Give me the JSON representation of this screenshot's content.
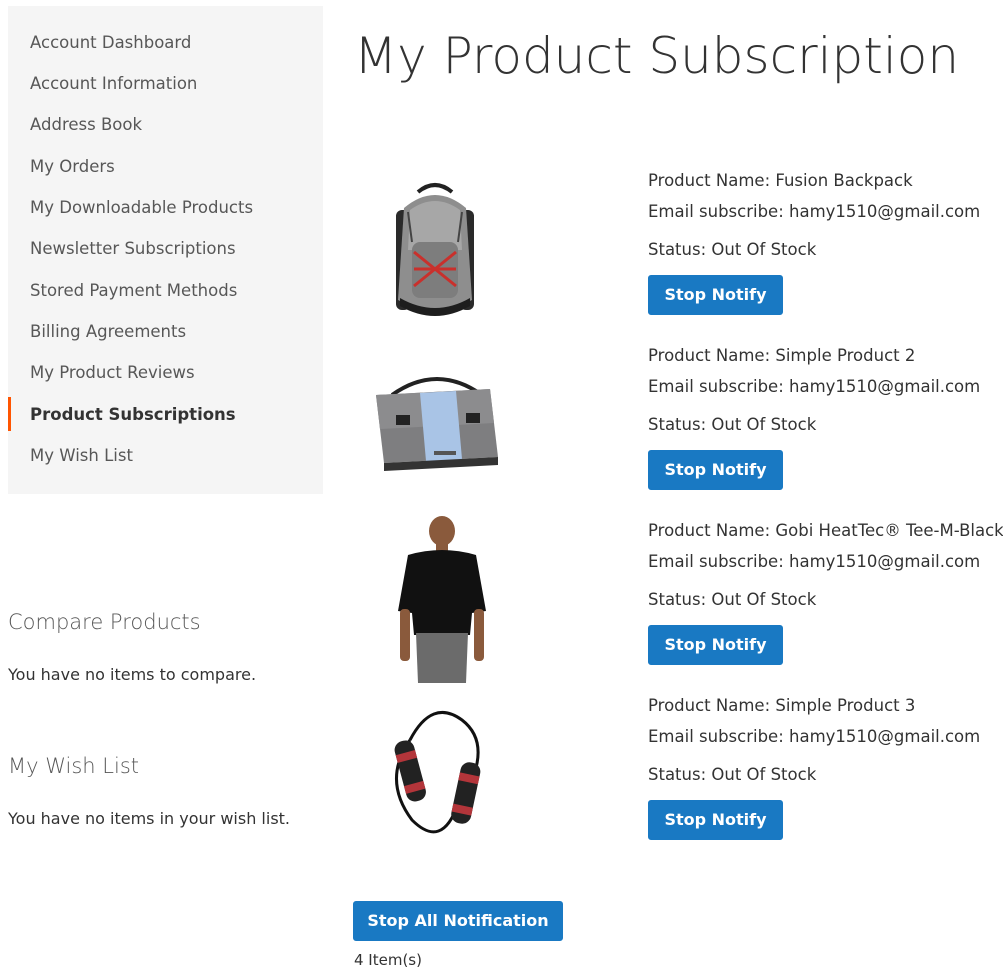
{
  "sidebar": {
    "items": [
      {
        "label": "Account Dashboard",
        "active": false
      },
      {
        "label": "Account Information",
        "active": false
      },
      {
        "label": "Address Book",
        "active": false
      },
      {
        "label": "My Orders",
        "active": false
      },
      {
        "label": "My Downloadable Products",
        "active": false
      },
      {
        "label": "Newsletter Subscriptions",
        "active": false
      },
      {
        "label": "Stored Payment Methods",
        "active": false
      },
      {
        "label": "Billing Agreements",
        "active": false
      },
      {
        "label": "My Product Reviews",
        "active": false
      },
      {
        "label": "Product Subscriptions",
        "active": true
      },
      {
        "label": "My Wish List",
        "active": false
      }
    ],
    "active_color": "#ff5501"
  },
  "compare": {
    "title": "Compare Products",
    "empty_text": "You have no items to compare."
  },
  "wishlist": {
    "title": "My Wish List",
    "empty_text": "You have no items in your wish list."
  },
  "main": {
    "title": "My Product Subscription",
    "subscriptions": [
      {
        "image_icon": "backpack-image",
        "name_line": "Product Name: Fusion Backpack",
        "email_line": "Email subscribe: hamy1510@gmail.com",
        "status_line": "Status: Out Of Stock",
        "button_label": "Stop Notify"
      },
      {
        "image_icon": "messenger-bag-image",
        "name_line": "Product Name: Simple Product 2",
        "email_line": "Email subscribe: hamy1510@gmail.com",
        "status_line": "Status: Out Of Stock",
        "button_label": "Stop Notify"
      },
      {
        "image_icon": "tshirt-model-image",
        "name_line": "Product Name: Gobi HeatTec® Tee-M-Black",
        "email_line": "Email subscribe: hamy1510@gmail.com",
        "status_line": "Status: Out Of Stock",
        "button_label": "Stop Notify"
      },
      {
        "image_icon": "jump-rope-image",
        "name_line": "Product Name: Simple Product 3",
        "email_line": "Email subscribe: hamy1510@gmail.com",
        "status_line": "Status: Out Of Stock",
        "button_label": "Stop Notify"
      }
    ],
    "stop_all_label": "Stop All Notification",
    "item_count": "4 Item(s)"
  },
  "colors": {
    "button": "#1979c3",
    "sidebar_bg": "#f5f5f5",
    "text": "#333333"
  }
}
